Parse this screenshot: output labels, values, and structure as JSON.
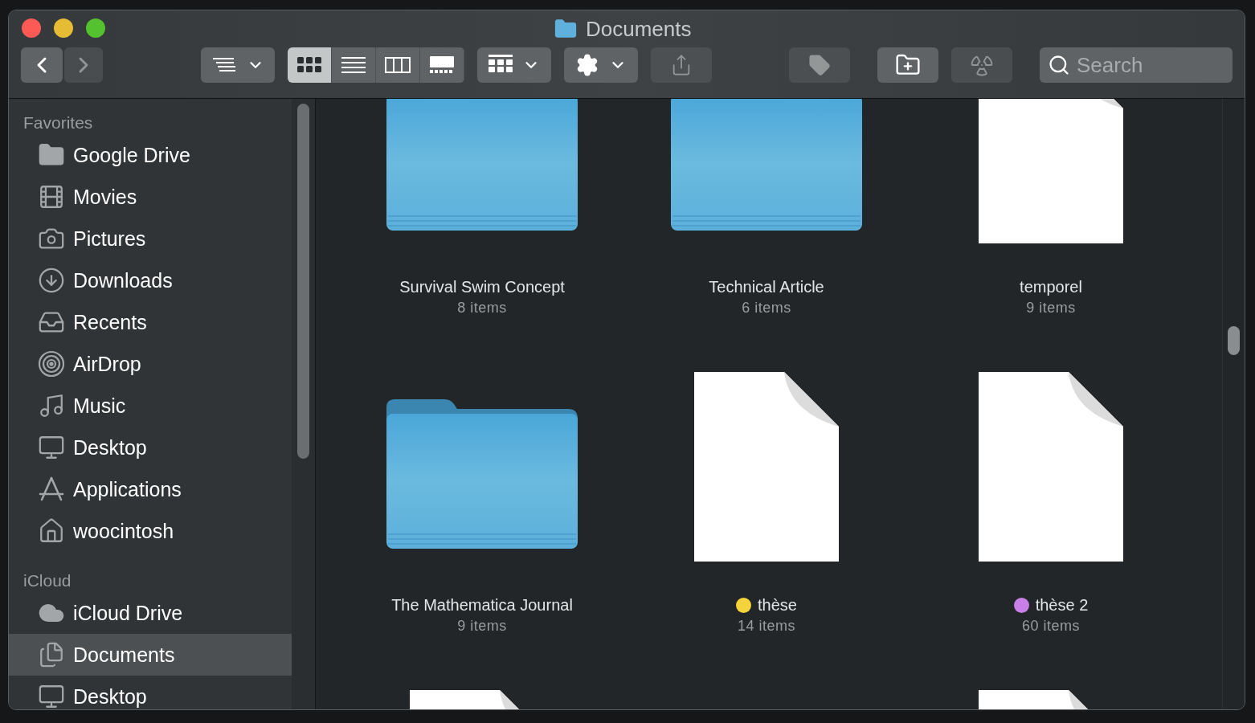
{
  "window": {
    "title": "Documents"
  },
  "toolbar": {
    "buttons": [
      {
        "kind": "back",
        "disabled": false
      },
      {
        "kind": "forward",
        "disabled": true
      },
      {
        "kind": "arrange",
        "disabled": false
      },
      {
        "kind": "group",
        "disabled": false
      },
      {
        "kind": "action",
        "disabled": false
      },
      {
        "kind": "share",
        "disabled": true
      },
      {
        "kind": "tag",
        "disabled": true
      },
      {
        "kind": "new-folder",
        "disabled": false
      },
      {
        "kind": "burn",
        "disabled": true
      }
    ],
    "view_modes": [
      {
        "kind": "icons",
        "selected": true
      },
      {
        "kind": "list",
        "selected": false
      },
      {
        "kind": "columns",
        "selected": false
      },
      {
        "kind": "gallery",
        "selected": false
      }
    ],
    "search": {
      "placeholder": "Search"
    }
  },
  "sidebar": {
    "sections": [
      {
        "heading": "Favorites",
        "items": [
          {
            "label": "Google Drive",
            "kind": "folder",
            "selected": false
          },
          {
            "label": "Movies",
            "kind": "film",
            "selected": false
          },
          {
            "label": "Pictures",
            "kind": "camera",
            "selected": false
          },
          {
            "label": "Downloads",
            "kind": "download",
            "selected": false
          },
          {
            "label": "Recents",
            "kind": "recents",
            "selected": false
          },
          {
            "label": "AirDrop",
            "kind": "airdrop",
            "selected": false
          },
          {
            "label": "Music",
            "kind": "music",
            "selected": false
          },
          {
            "label": "Desktop",
            "kind": "desktop",
            "selected": false
          },
          {
            "label": "Applications",
            "kind": "applications",
            "selected": false
          },
          {
            "label": "woocintosh",
            "kind": "home",
            "selected": false
          }
        ]
      },
      {
        "heading": "iCloud",
        "items": [
          {
            "label": "iCloud Drive",
            "kind": "cloud",
            "selected": false
          },
          {
            "label": "Documents",
            "kind": "documents",
            "selected": true
          },
          {
            "label": "Desktop",
            "kind": "desktop",
            "selected": false
          }
        ]
      }
    ]
  },
  "items": [
    {
      "kind": "folder",
      "name": "Survival Swim Concept",
      "count": "8 items"
    },
    {
      "kind": "folder",
      "name": "Technical Article",
      "count": "6 items"
    },
    {
      "kind": "file",
      "name": "temporel",
      "count": "9 items"
    },
    {
      "kind": "folder",
      "name": "The Mathematica Journal",
      "count": "9 items"
    },
    {
      "kind": "file",
      "name": "thèse",
      "count": "14 items",
      "color": "#f5d33b"
    },
    {
      "kind": "file",
      "name": "thèse 2",
      "count": "60 items",
      "color": "#c97fe8"
    },
    {
      "kind": "file"
    },
    {
      "kind": "empty"
    },
    {
      "kind": "file"
    }
  ]
}
